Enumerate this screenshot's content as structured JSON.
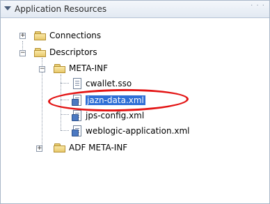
{
  "panel": {
    "title": "Application Resources",
    "header_dots": "· · ·"
  },
  "tree": {
    "connections": "Connections",
    "descriptors": "Descriptors",
    "meta_inf": "META-INF",
    "cwallet": "cwallet.sso",
    "jazn_data": "jazn-data.xml",
    "jps_config": "jps-config.xml",
    "weblogic_app": "weblogic-application.xml",
    "adf_meta_inf": "ADF META-INF"
  },
  "expanders": {
    "connections": "+",
    "descriptors": "−",
    "meta_inf": "−",
    "adf_meta_inf": "+"
  },
  "colors": {
    "selection": "#2f6fd6",
    "annotation": "#e31414"
  }
}
